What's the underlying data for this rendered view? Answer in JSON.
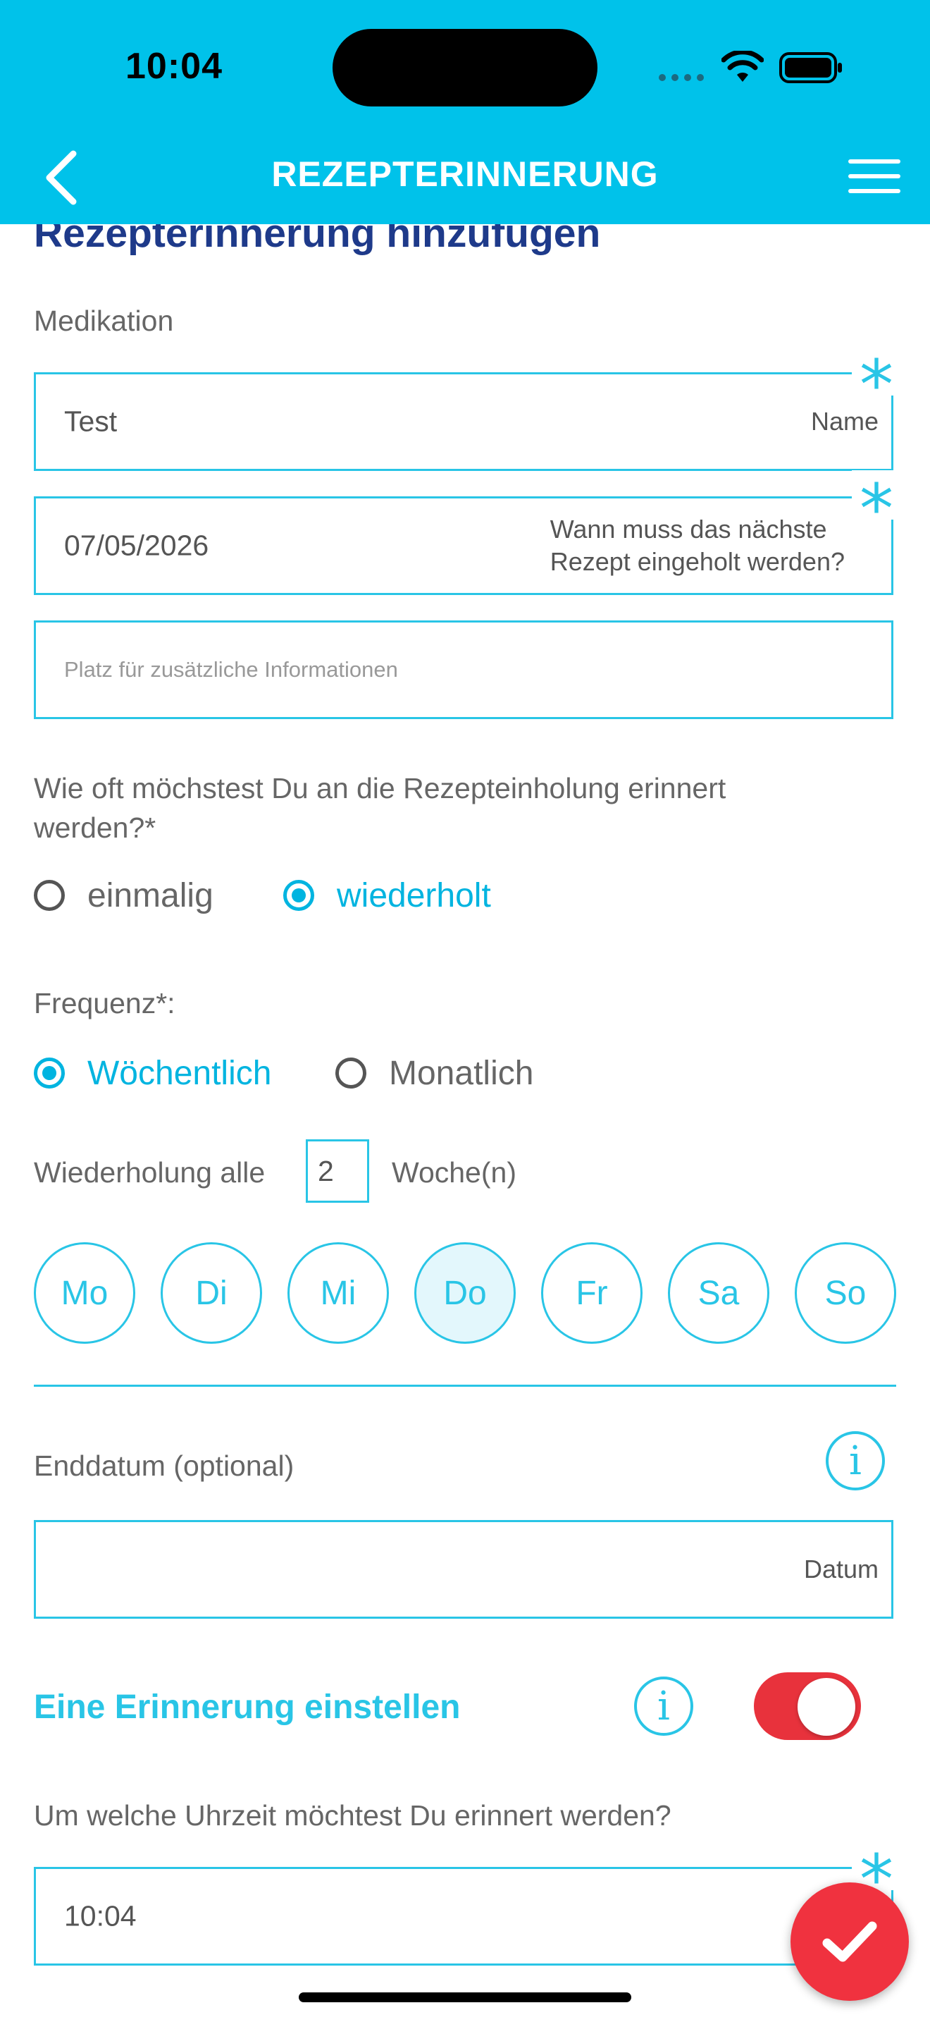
{
  "status_bar": {
    "time": "10:04"
  },
  "header": {
    "title": "REZEPTERINNERUNG"
  },
  "form": {
    "heading": "Rezepterinnerung hinzufügen",
    "medication_label": "Medikation",
    "name_field": {
      "value": "Test",
      "hint": "Name",
      "required_mark": "*"
    },
    "date_field": {
      "value": "07/05/2026",
      "hint_line1": "Wann muss das nächste",
      "hint_line2": "Rezept eingeholt werden?",
      "required_mark": "*"
    },
    "info_field": {
      "placeholder": "Platz für zusätzliche Informationen"
    },
    "frequency_question_line1": "Wie oft möchstest Du an die Rezepteinholung erinnert",
    "frequency_question_line2": "werden?*",
    "mode_options": [
      {
        "label": "einmalig",
        "selected": false
      },
      {
        "label": "wiederholt",
        "selected": true
      }
    ],
    "frequency_label": "Frequenz*:",
    "frequency_options": [
      {
        "label": "Wöchentlich",
        "selected": true
      },
      {
        "label": "Monatlich",
        "selected": false
      }
    ],
    "repeat_prefix": "Wiederholung alle",
    "repeat_value": "2",
    "repeat_suffix": "Woche(n)",
    "days": [
      {
        "label": "Mo",
        "selected": false
      },
      {
        "label": "Di",
        "selected": false
      },
      {
        "label": "Mi",
        "selected": false
      },
      {
        "label": "Do",
        "selected": true
      },
      {
        "label": "Fr",
        "selected": false
      },
      {
        "label": "Sa",
        "selected": false
      },
      {
        "label": "So",
        "selected": false
      }
    ],
    "end_date_label": "Enddatum (optional)",
    "end_date_field": {
      "value": "",
      "hint": "Datum"
    },
    "info_icon_glyph": "i",
    "reminder_heading": "Eine Erinnerung einstellen",
    "reminder_enabled": true,
    "time_question": "Um welche Uhrzeit möchtest Du erinnert werden?",
    "time_field": {
      "value": "10:04",
      "required_mark": "*"
    }
  },
  "colors": {
    "header": "#00C2EA",
    "accent": "#29C5E6",
    "heading": "#1E3A8A",
    "toggle_on": "#E8323C",
    "fab": "#F0323F"
  }
}
